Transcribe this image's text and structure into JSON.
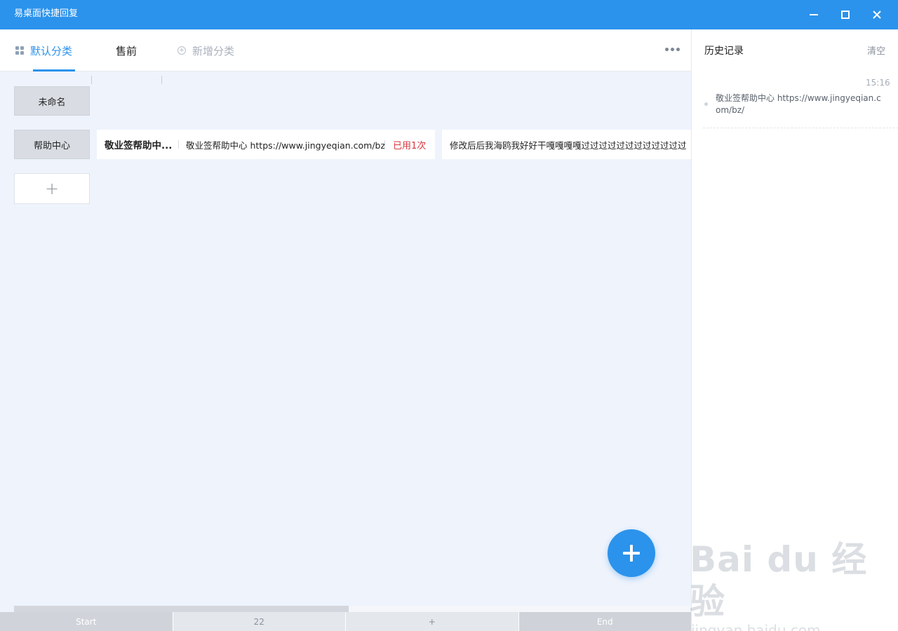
{
  "window": {
    "title": "易桌面快捷回复",
    "close_glyph": "✕"
  },
  "tabs": [
    {
      "label": "默认分类",
      "icon": "grid-icon",
      "active": true
    },
    {
      "label": "售前",
      "active": false
    },
    {
      "label": "新增分类",
      "icon": "plus-circle-icon",
      "active": false
    }
  ],
  "categories": [
    {
      "label": "未命名"
    },
    {
      "label": "帮助中心"
    }
  ],
  "add_category_label": "+",
  "replies": [
    {
      "title": "敬业签帮助中...",
      "content": "敬业签帮助中心 https://www.jingyeqian.com/bz/",
      "usage": "已用1次"
    },
    {
      "content": "修改后后我海鸥我好好干嘎嘎嘎嘎过过过过过过过过过过过过"
    }
  ],
  "bottom_nav": {
    "start": "Start",
    "page": "22",
    "add": "+",
    "end": "End"
  },
  "history": {
    "title": "历史记录",
    "clear_label": "清空",
    "items": [
      {
        "time": "15:16",
        "text": "敬业签帮助中心 https://www.jingyeqian.com/bz/"
      }
    ]
  },
  "watermark": {
    "brand": "Bai du 经验",
    "url": "jingyan.baidu.com"
  },
  "colors": {
    "accent": "#2b93ec",
    "usage_red": "#d9363e",
    "background": "#eef3fc"
  }
}
